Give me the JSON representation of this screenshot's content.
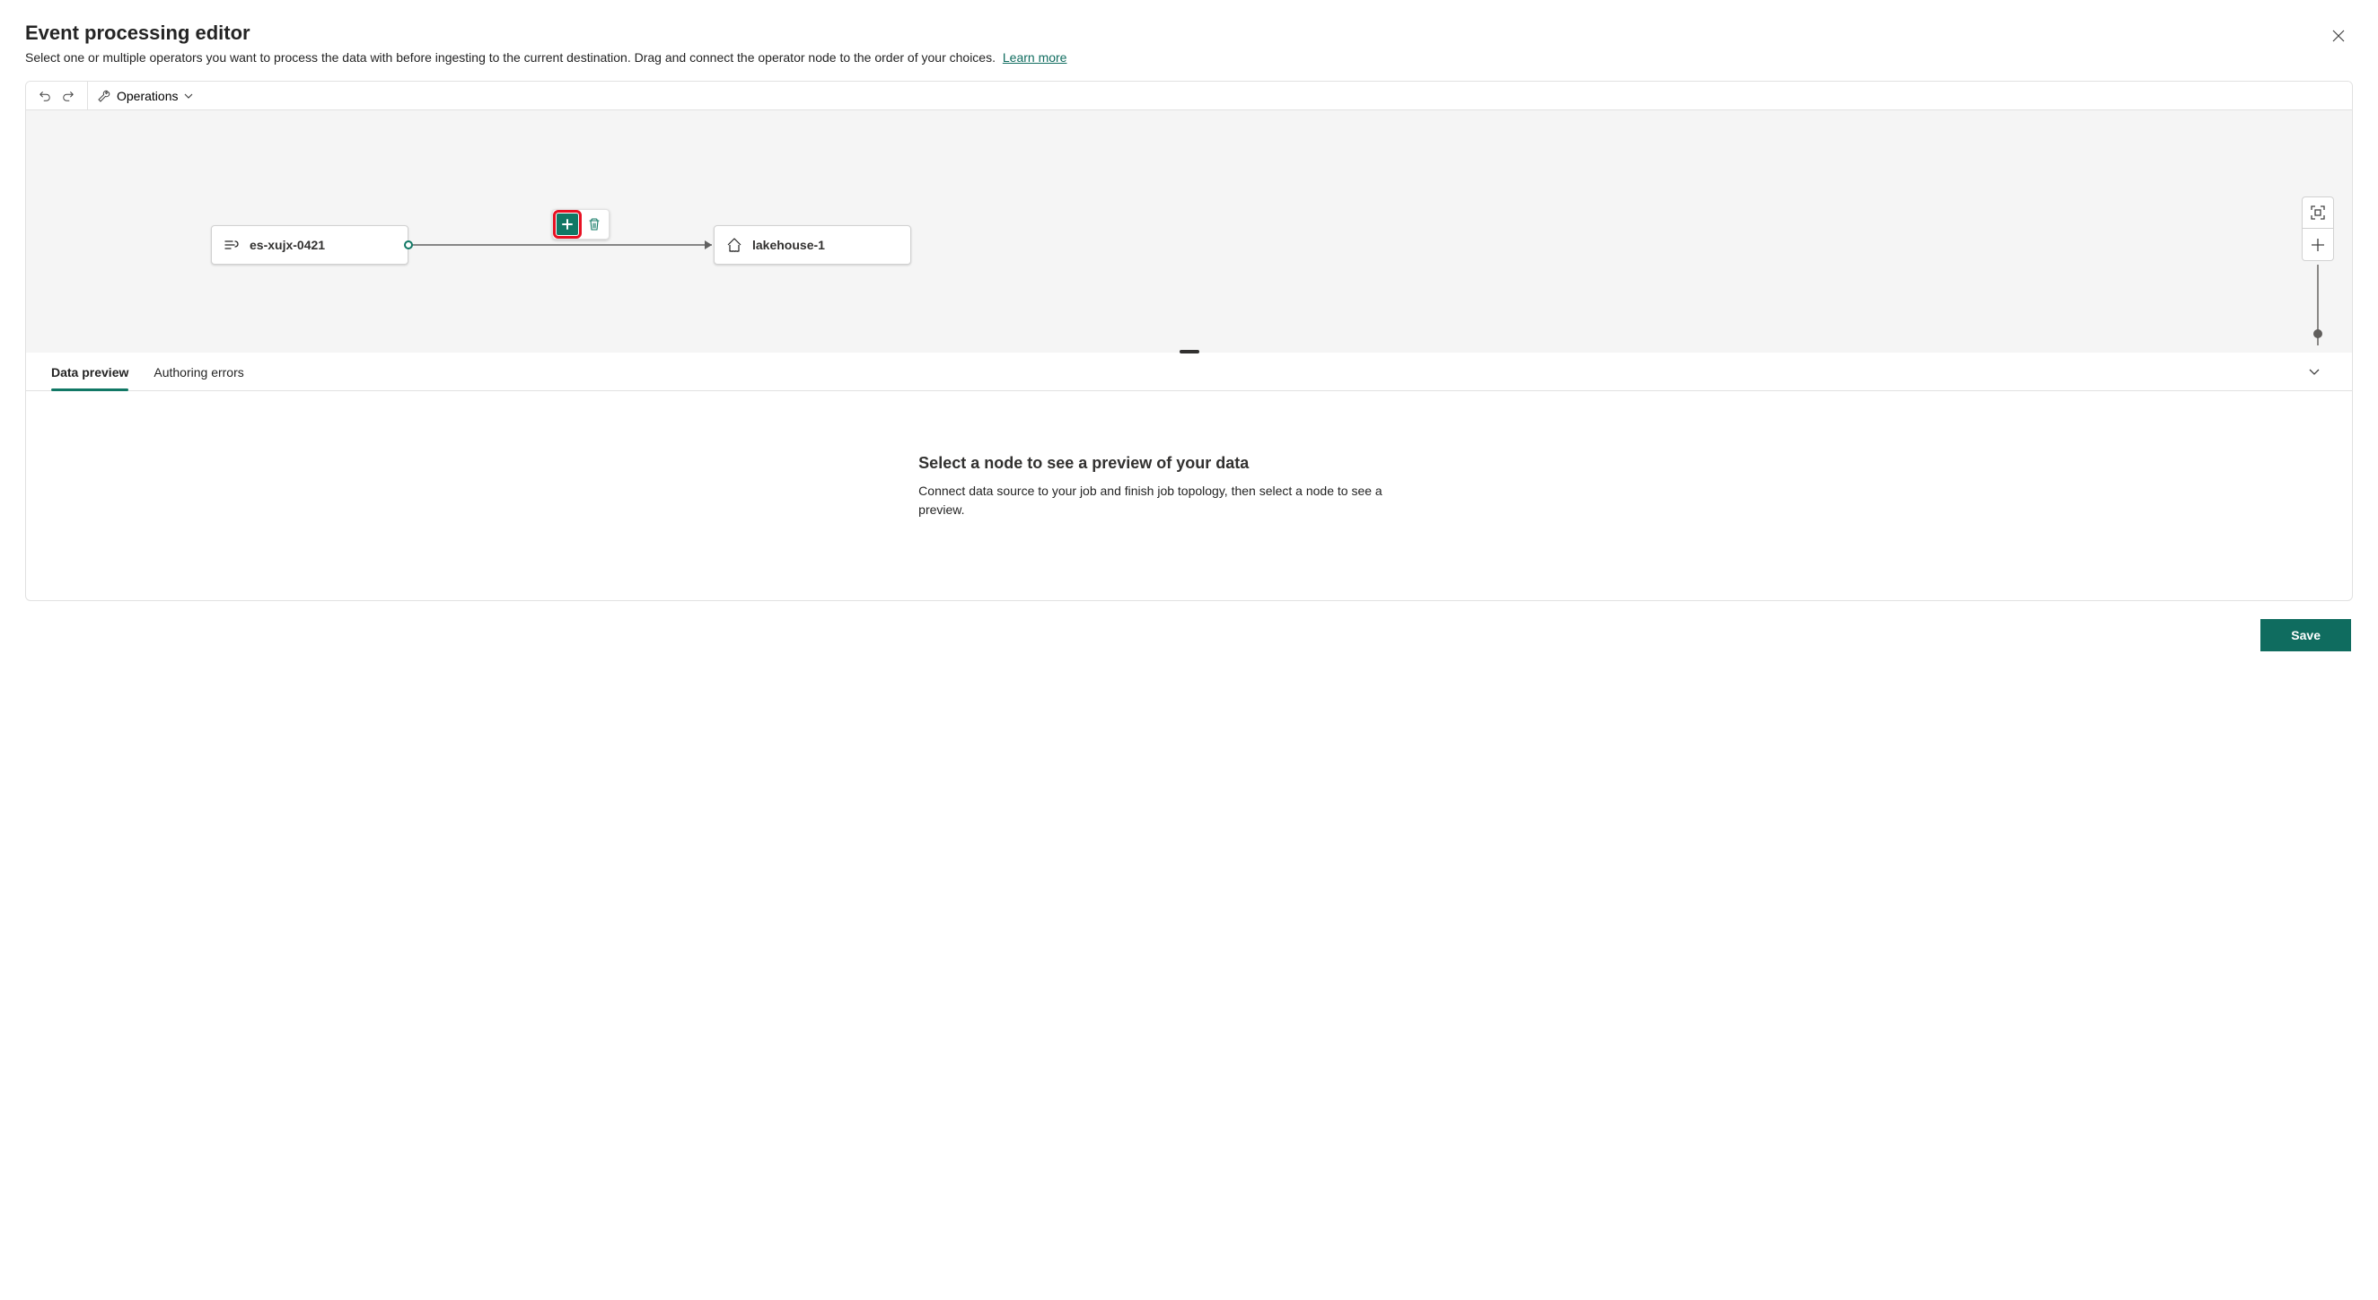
{
  "header": {
    "title": "Event processing editor",
    "subtitle": "Select one or multiple operators you want to process the data with before ingesting to the current destination. Drag and connect the operator node to the order of your choices.",
    "learn_more": "Learn more"
  },
  "toolbar": {
    "operations_label": "Operations"
  },
  "canvas": {
    "source_node": {
      "label": "es-xujx-0421"
    },
    "dest_node": {
      "label": "lakehouse-1"
    }
  },
  "tabs": {
    "data_preview": "Data preview",
    "authoring_errors": "Authoring errors"
  },
  "preview": {
    "title": "Select a node to see a preview of your data",
    "text": "Connect data source to your job and finish job topology, then select a node to see a preview."
  },
  "footer": {
    "save_label": "Save"
  }
}
